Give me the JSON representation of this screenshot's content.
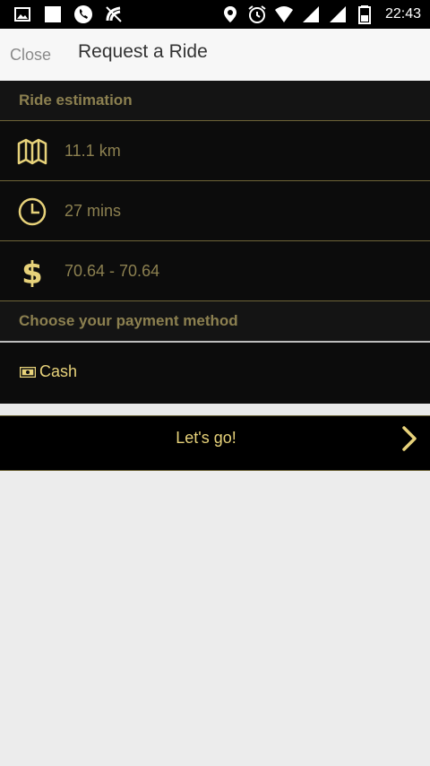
{
  "status_bar": {
    "time": "22:43",
    "left_icons": [
      "gallery-icon",
      "square-icon",
      "phone-icon",
      "signal-off-icon"
    ],
    "right_icons": [
      "location-icon",
      "alarm-icon",
      "wifi-icon",
      "cell-signal-icon",
      "cell-signal-icon",
      "battery-icon"
    ]
  },
  "header": {
    "close_label": "Close",
    "title": "Request a Ride"
  },
  "estimation": {
    "section_title": "Ride estimation",
    "distance": "11.1 km",
    "duration": "27 mins",
    "price": "70.64 - 70.64",
    "icons": [
      "map-icon",
      "clock-icon",
      "dollar-icon"
    ]
  },
  "payment": {
    "section_title": "Choose your payment method",
    "selected_method": "Cash",
    "method_icon": "cash-icon"
  },
  "action": {
    "go_label": "Let's go!",
    "arrow_icon": "chevron-right-icon"
  },
  "colors": {
    "accent": "#e7d27a",
    "muted_gold": "#8c8050",
    "panel_bg": "#0c0c0c",
    "divider": "#6e6438"
  }
}
